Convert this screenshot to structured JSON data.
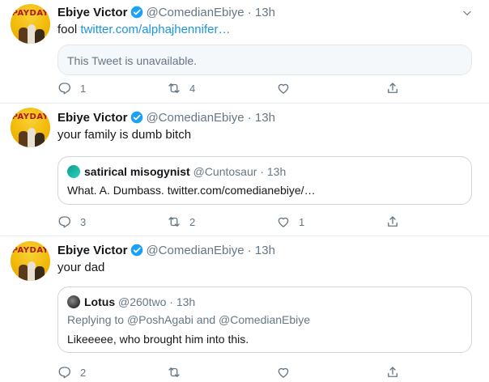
{
  "tweets": [
    {
      "name": "Ebiye Victor",
      "handle": "@ComedianEbiye",
      "sep": "·",
      "time": "13h",
      "text_prefix": "fool ",
      "link": "twitter.com/alphajhennifer…",
      "unavailable": "This Tweet is unavailable.",
      "replies": "1",
      "retweets": "4",
      "likes": ""
    },
    {
      "name": "Ebiye Victor",
      "handle": "@ComedianEbiye",
      "sep": "·",
      "time": "13h",
      "text": "your family is dumb bitch",
      "quote": {
        "name": "satirical misogynist",
        "handle": "@Cuntosaur",
        "sep": "·",
        "time": "13h",
        "text": "What. A. Dumbass. twitter.com/comedianebiye/…"
      },
      "replies": "3",
      "retweets": "2",
      "likes": "1"
    },
    {
      "name": "Ebiye Victor",
      "handle": "@ComedianEbiye",
      "sep": "·",
      "time": "13h",
      "text": "your dad",
      "quote": {
        "name": "Lotus",
        "handle": "@260two",
        "sep": "·",
        "time": "13h",
        "replying_prefix": "Replying to ",
        "replying_to_1": "@PoshAgabi",
        "replying_and": " and ",
        "replying_to_2": "@ComedianEbiye",
        "text": "Likeeeee, who brought him into this."
      },
      "replies": "2",
      "retweets": "",
      "likes": ""
    }
  ],
  "avatar_text": "PAYDAY",
  "colors": {
    "verified": "#1da1f2",
    "link": "#1b95e0",
    "muted": "#657786"
  }
}
